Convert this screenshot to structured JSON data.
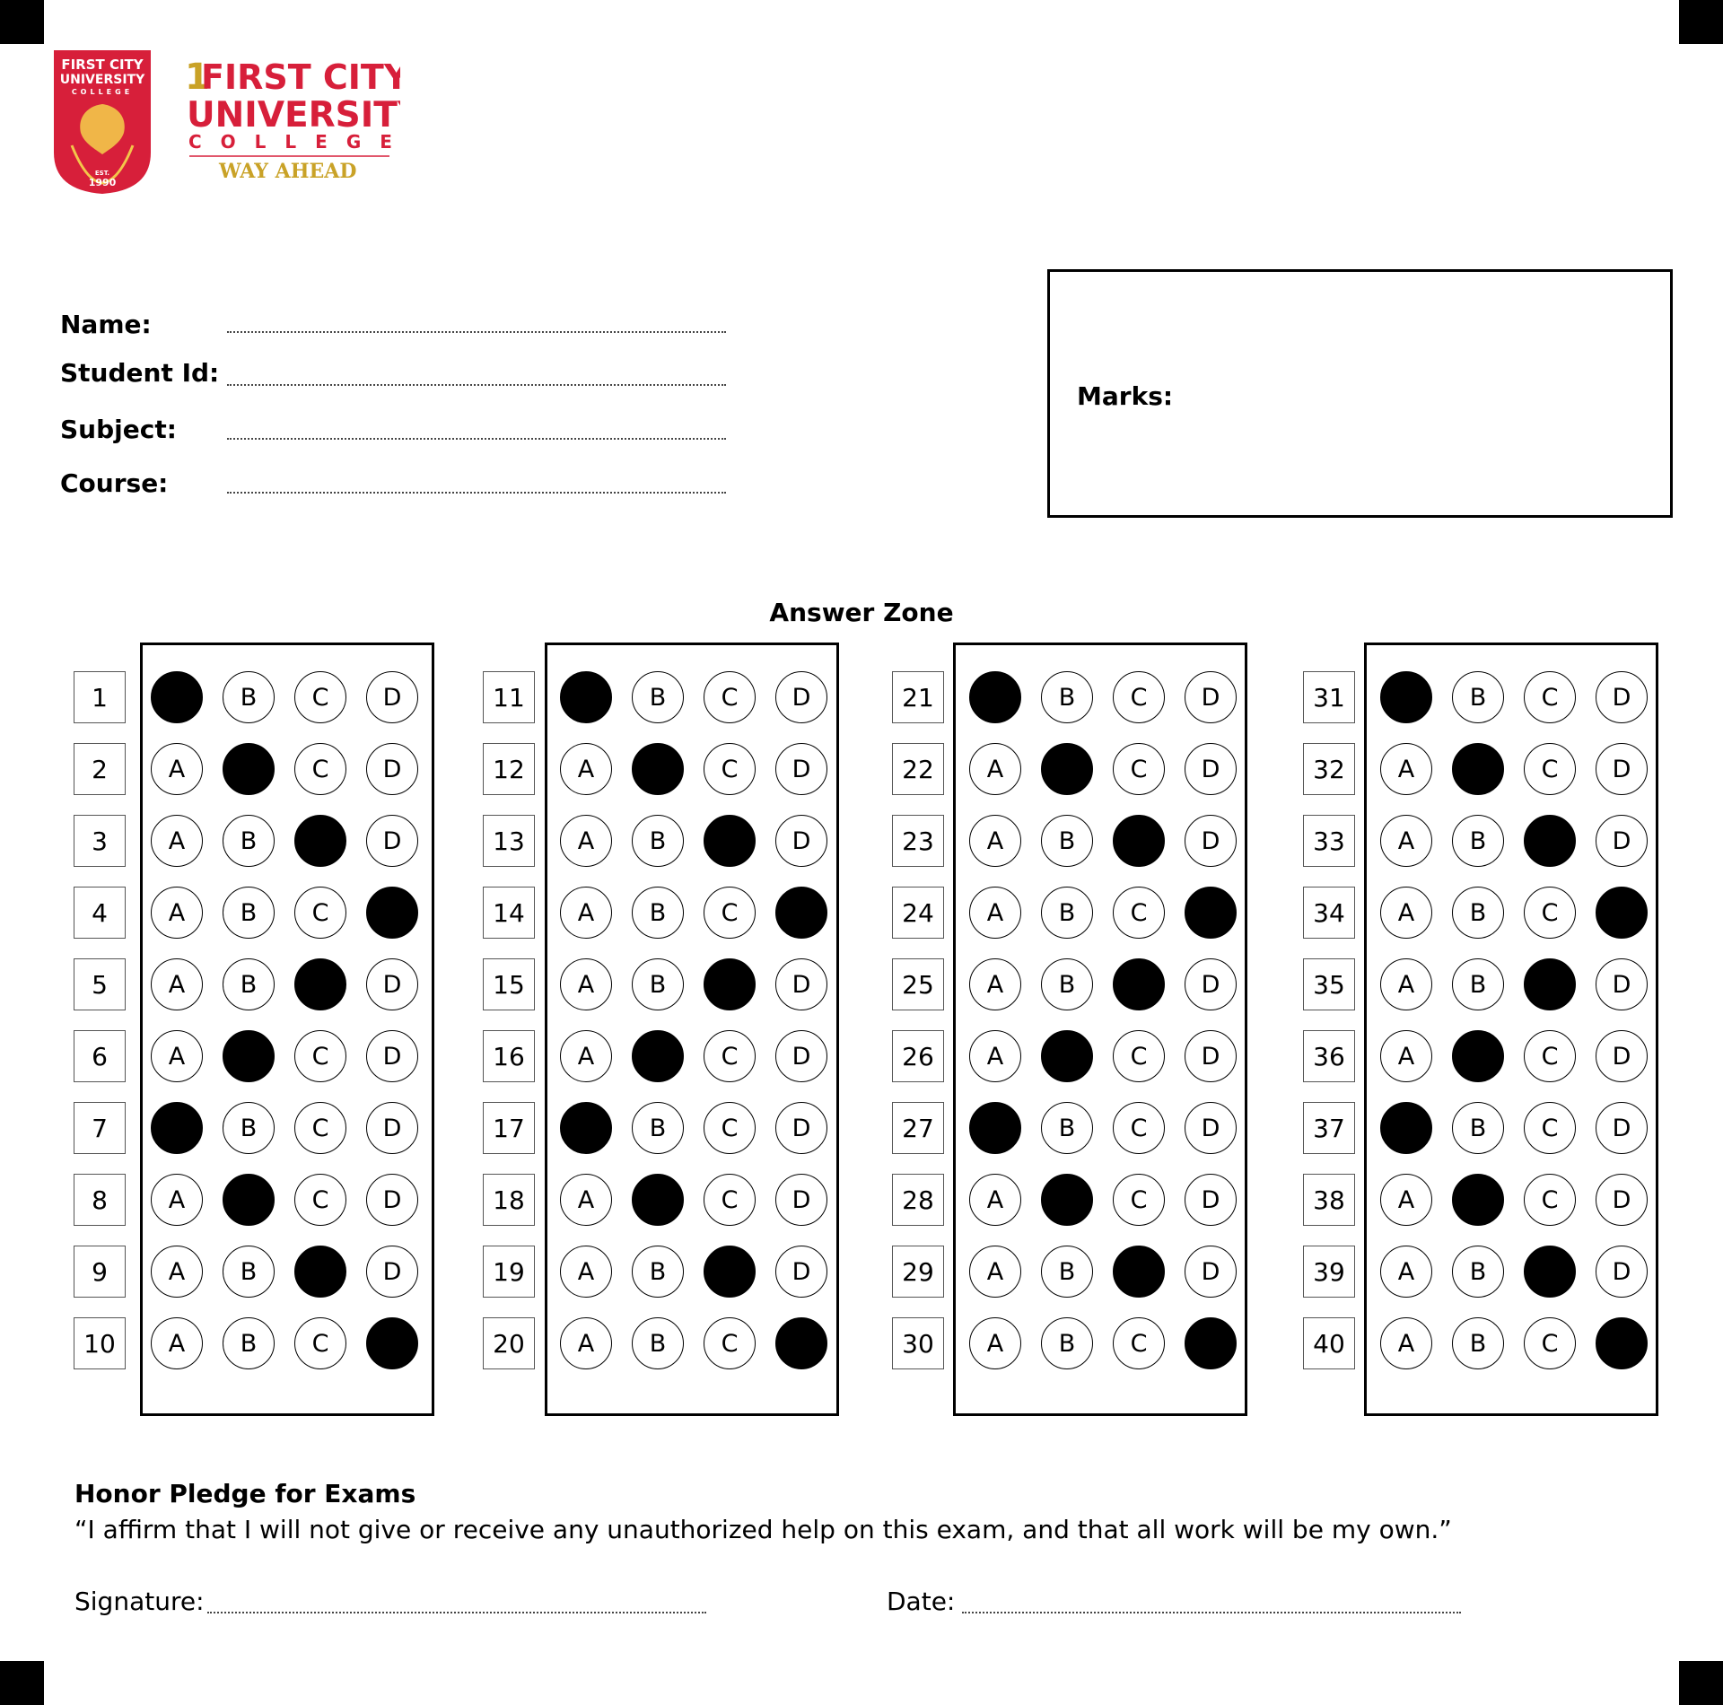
{
  "brand": {
    "seal_line1": "FIRST CITY",
    "seal_line2": "UNIVERSITY",
    "seal_line3": "COLLEGE",
    "seal_est": "EST.",
    "seal_year": "1990",
    "wordmark_numeral": "1",
    "wordmark_line1": "FIRST CITY",
    "wordmark_line2": "UNIVERSITY",
    "wordmark_line3": "COLLEGE",
    "tagline": "WAY AHEAD",
    "colors": {
      "red": "#d71f3a",
      "gold": "#c9a227"
    }
  },
  "fields": {
    "name_label": "Name:",
    "student_id_label": "Student Id:",
    "subject_label": "Subject:",
    "course_label": "Course:"
  },
  "marks": {
    "label": "Marks:"
  },
  "answer_zone": {
    "title": "Answer Zone",
    "options": [
      "A",
      "B",
      "C",
      "D"
    ],
    "questions": [
      {
        "number": "1",
        "answer": "A"
      },
      {
        "number": "2",
        "answer": "B"
      },
      {
        "number": "3",
        "answer": "C"
      },
      {
        "number": "4",
        "answer": "D"
      },
      {
        "number": "5",
        "answer": "C"
      },
      {
        "number": "6",
        "answer": "B"
      },
      {
        "number": "7",
        "answer": "A"
      },
      {
        "number": "8",
        "answer": "B"
      },
      {
        "number": "9",
        "answer": "C"
      },
      {
        "number": "10",
        "answer": "D"
      },
      {
        "number": "11",
        "answer": "A"
      },
      {
        "number": "12",
        "answer": "B"
      },
      {
        "number": "13",
        "answer": "C"
      },
      {
        "number": "14",
        "answer": "D"
      },
      {
        "number": "15",
        "answer": "C"
      },
      {
        "number": "16",
        "answer": "B"
      },
      {
        "number": "17",
        "answer": "A"
      },
      {
        "number": "18",
        "answer": "B"
      },
      {
        "number": "19",
        "answer": "C"
      },
      {
        "number": "20",
        "answer": "D"
      },
      {
        "number": "21",
        "answer": "A"
      },
      {
        "number": "22",
        "answer": "B"
      },
      {
        "number": "23",
        "answer": "C"
      },
      {
        "number": "24",
        "answer": "D"
      },
      {
        "number": "25",
        "answer": "C"
      },
      {
        "number": "26",
        "answer": "B"
      },
      {
        "number": "27",
        "answer": "A"
      },
      {
        "number": "28",
        "answer": "B"
      },
      {
        "number": "29",
        "answer": "C"
      },
      {
        "number": "30",
        "answer": "D"
      },
      {
        "number": "31",
        "answer": "A"
      },
      {
        "number": "32",
        "answer": "B"
      },
      {
        "number": "33",
        "answer": "C"
      },
      {
        "number": "34",
        "answer": "D"
      },
      {
        "number": "35",
        "answer": "C"
      },
      {
        "number": "36",
        "answer": "B"
      },
      {
        "number": "37",
        "answer": "A"
      },
      {
        "number": "38",
        "answer": "B"
      },
      {
        "number": "39",
        "answer": "C"
      },
      {
        "number": "40",
        "answer": "D"
      }
    ]
  },
  "pledge": {
    "title": "Honor Pledge for Exams",
    "text": "“I affirm that I will not give or receive any unauthorized help on this exam, and that all work will be my own.”",
    "signature_label": "Signature:",
    "date_label": "Date:"
  }
}
